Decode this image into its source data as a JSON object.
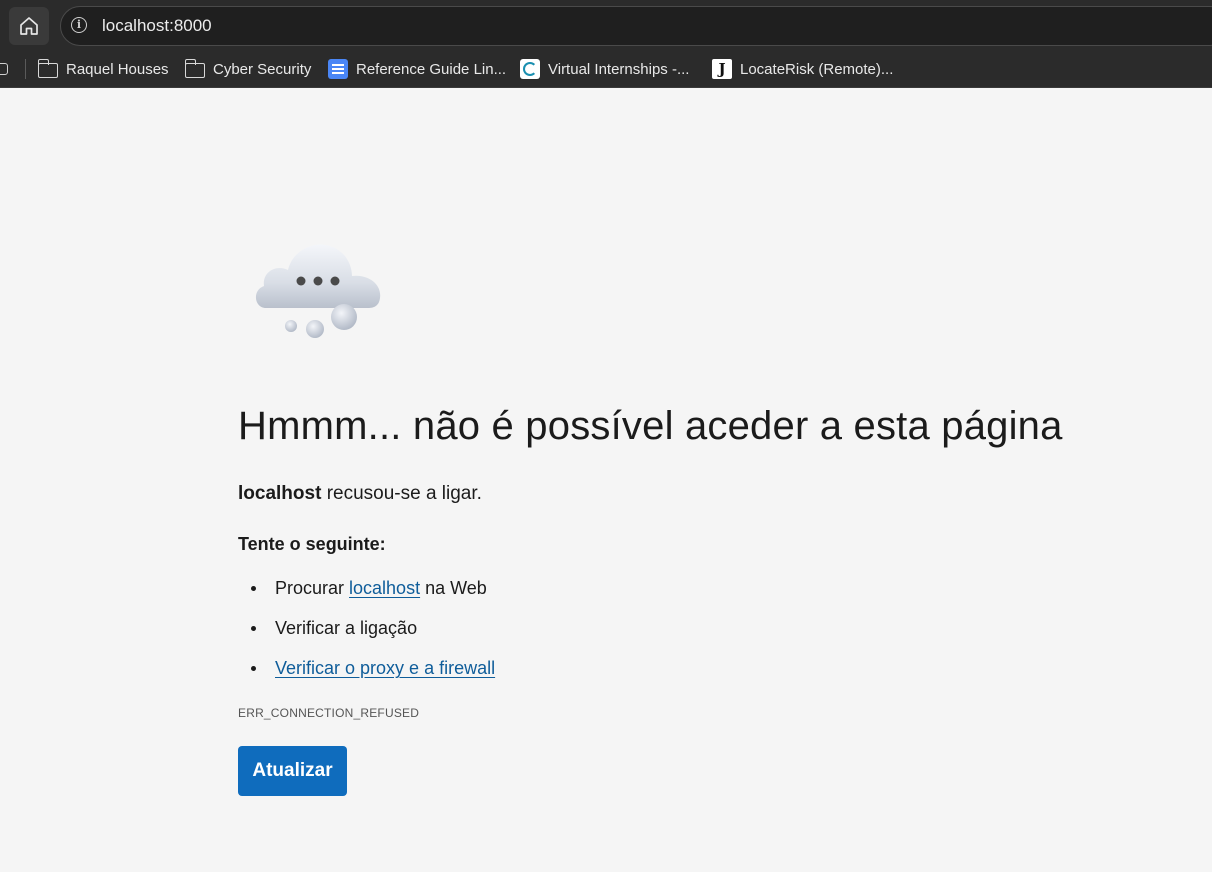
{
  "browser": {
    "url": "localhost:8000",
    "bookmarks": [
      {
        "label": "Raquel Houses",
        "icon": "folder-icon"
      },
      {
        "label": "Cyber Security",
        "icon": "folder-icon"
      },
      {
        "label": "Reference Guide Lin...",
        "icon": "google-docs-icon"
      },
      {
        "label": "Virtual Internships -...",
        "icon": "virtual-internships-icon"
      },
      {
        "label": "LocateRisk (Remote)...",
        "icon": "locaterisk-icon"
      }
    ]
  },
  "error_page": {
    "title": "Hmmm... não é possível aceder a esta página",
    "host": "localhost",
    "message": "recusou-se a ligar.",
    "try_heading": "Tente o seguinte:",
    "suggestions": {
      "search_prefix": "Procurar ",
      "search_link": "localhost",
      "search_suffix": " na Web",
      "check_connection": "Verificar a ligação",
      "check_proxy": "Verificar o proxy e a firewall"
    },
    "error_code": "ERR_CONNECTION_REFUSED",
    "refresh_button": "Atualizar"
  },
  "colors": {
    "accent": "#0f6cbd",
    "link": "#0f5d9a",
    "page_background": "#f5f5f5",
    "chrome_background": "#2b2b2b"
  }
}
